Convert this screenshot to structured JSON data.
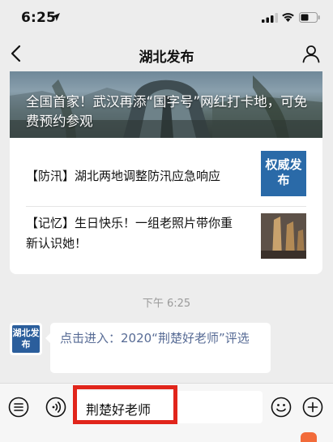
{
  "status_bar": {
    "time": "6:25"
  },
  "nav": {
    "title": "湖北发布"
  },
  "article": {
    "hero_title": "全国首家！武汉再添“国字号”网红打卡地，可免费预约参观",
    "items": [
      {
        "text": "【防汛】湖北两地调整防汛应急响应",
        "thumb_label": "权威发布"
      },
      {
        "text": "【记忆】生日快乐！一组老照片带你重新认识她！"
      }
    ]
  },
  "chat": {
    "timestamp": "下午 6:25",
    "avatar_label": "湖北发布",
    "message": "点击进入：2020“荆楚好老师”评选"
  },
  "input_bar": {
    "value": "荆楚好老师"
  },
  "colors": {
    "link": "#576b95",
    "highlight": "#e1251b",
    "authority_blue": "#2a6aa8"
  }
}
